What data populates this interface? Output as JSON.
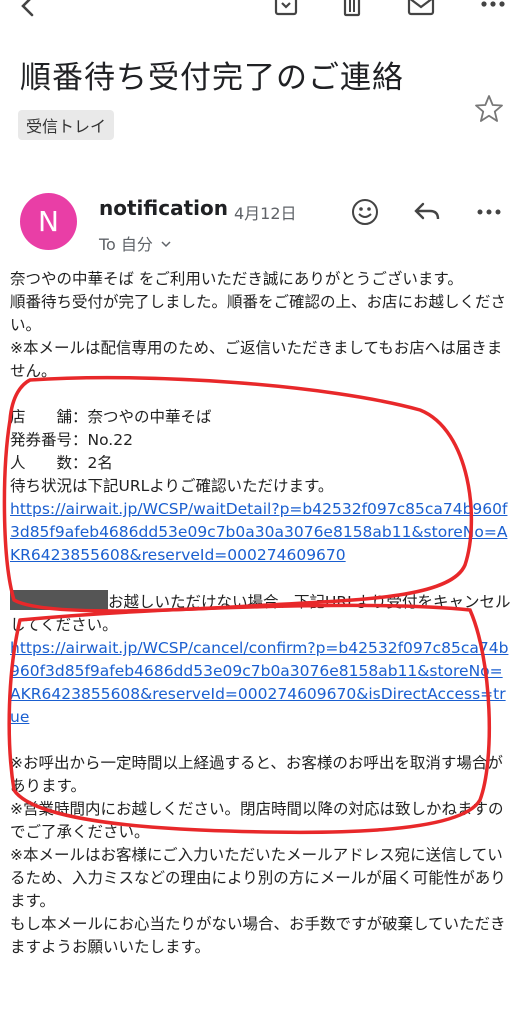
{
  "email": {
    "subject": "順番待ち受付完了のご連絡",
    "label": "受信トレイ",
    "sender": "notification",
    "avatar_letter": "N",
    "date": "4月12日",
    "recipient": "To 自分"
  },
  "body": {
    "intro1": "奈つやの中華そば をご利用いただき誠にありがとうございます。",
    "intro2": "順番待ち受付が完了しました。順番をご確認の上、お店にお越しください。",
    "notice1": "※本メールは配信専用のため、ご返信いただきましてもお店へは届きません。",
    "shop_line": "店　　舗：奈つやの中華そば",
    "ticket_line": "発券番号：No.22",
    "people_line": "人　　数：2名",
    "status_line": "待ち状況は下記URLよりご確認いただけます。",
    "wait_url": "https://airwait.jp/WCSP/waitDetail?p=b42532f097c85ca74b960f3d85f9afeb4686dd53e09c7b0a30a3076e8158ab11&storeNo=AKR6423855608&reserveId=000274609670",
    "cancel_text": "お越しいただけない場合、下記URLより受付をキャンセルしてください。",
    "cancel_url": "https://airwait.jp/WCSP/cancel/confirm?p=b42532f097c85ca74b960f3d85f9afeb4686dd53e09c7b0a3076e8158ab11&storeNo=AKR6423855608&reserveId=000274609670&isDirectAccess=true",
    "note_call": "※お呼出から一定時間以上経過すると、お客様のお呼出を取消す場合があります。",
    "note_hours": "※営業時間内にお越しください。閉店時間以降の対応は致しかねますのでご了承ください。",
    "note_address": "※本メールはお客様にご入力いただいたメールアドレス宛に送信しているため、入力ミスなどの理由により別の方にメールが届く可能性があります。",
    "note_discard": "もし本メールにお心当たりがない場合、お手数ですが破棄していただきますようお願いいたします。"
  },
  "icons": {
    "toolbar": [
      "back-arrow-icon",
      "archive-icon",
      "trash-icon",
      "mail-icon",
      "more-vertical-icon"
    ],
    "header": [
      "emoji-icon",
      "reply-icon",
      "more-horizontal-icon"
    ],
    "star": "star-icon"
  },
  "colors": {
    "avatar": "#e93ea6",
    "link": "#1a5fd0",
    "annotation": "#e8282a"
  }
}
